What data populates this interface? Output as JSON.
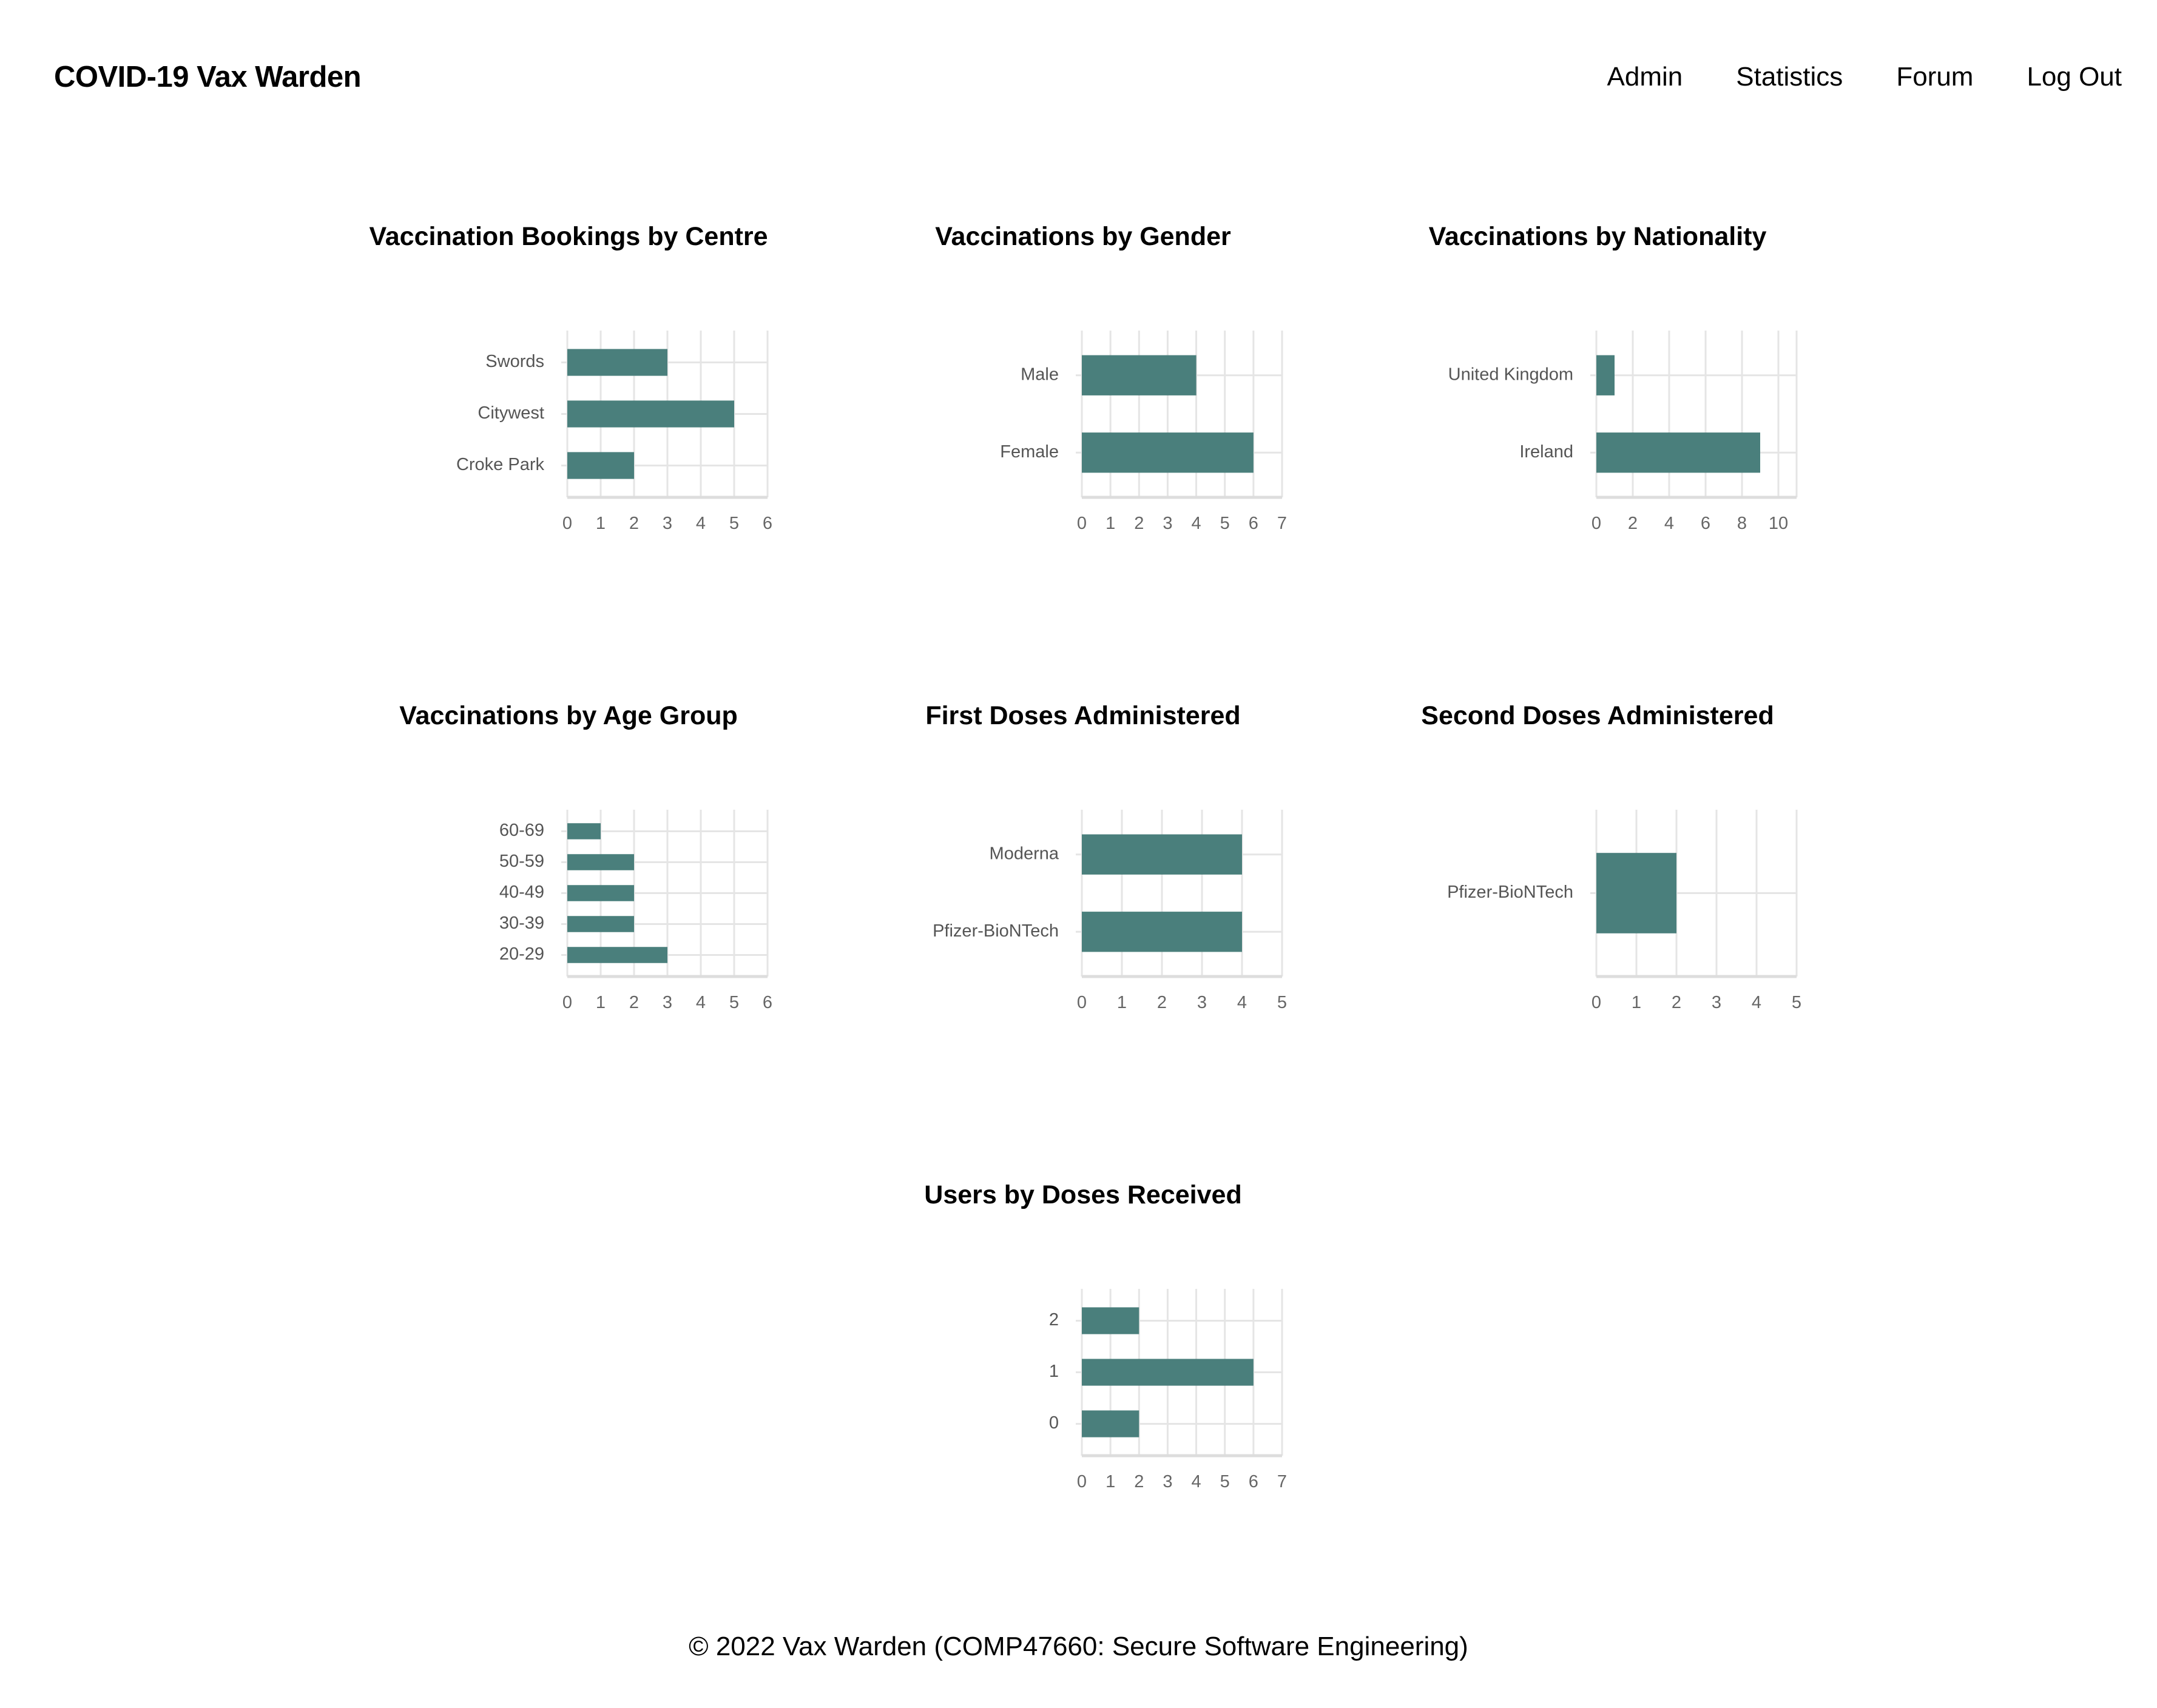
{
  "app": {
    "brand": "COVID-19 Vax Warden"
  },
  "nav": {
    "items": [
      {
        "label": "Admin"
      },
      {
        "label": "Statistics"
      },
      {
        "label": "Forum"
      },
      {
        "label": "Log Out"
      }
    ]
  },
  "footer": {
    "text": "© 2022 Vax Warden (COMP47660: Secure Software Engineering)"
  },
  "colors": {
    "bar": "#4a7f7c",
    "grid": "#e5e5e5",
    "tick_text": "#666666",
    "category_text": "#555555"
  },
  "chart_data": [
    {
      "type": "bar",
      "orientation": "horizontal",
      "title": "Vaccination Bookings by Centre",
      "categories": [
        "Swords",
        "Citywest",
        "Croke Park"
      ],
      "values": [
        3,
        5,
        2
      ],
      "xlim": [
        0,
        6
      ],
      "xticks": [
        0,
        1,
        2,
        3,
        4,
        5,
        6
      ],
      "grid": true,
      "legend": "none"
    },
    {
      "type": "bar",
      "orientation": "horizontal",
      "title": "Vaccinations by Gender",
      "categories": [
        "Male",
        "Female"
      ],
      "values": [
        4,
        6
      ],
      "xlim": [
        0,
        7
      ],
      "xticks": [
        0,
        1,
        2,
        3,
        4,
        5,
        6,
        7
      ],
      "grid": true,
      "legend": "none"
    },
    {
      "type": "bar",
      "orientation": "horizontal",
      "title": "Vaccinations by Nationality",
      "categories": [
        "United Kingdom",
        "Ireland"
      ],
      "values": [
        1,
        9
      ],
      "xlim": [
        0,
        11
      ],
      "xticks": [
        0,
        2,
        4,
        6,
        8,
        10
      ],
      "grid": true,
      "legend": "none"
    },
    {
      "type": "bar",
      "orientation": "horizontal",
      "title": "Vaccinations by Age Group",
      "categories": [
        "60-69",
        "50-59",
        "40-49",
        "30-39",
        "20-29"
      ],
      "values": [
        1,
        2,
        2,
        2,
        3
      ],
      "xlim": [
        0,
        6
      ],
      "xticks": [
        0,
        1,
        2,
        3,
        4,
        5,
        6
      ],
      "grid": true,
      "legend": "none"
    },
    {
      "type": "bar",
      "orientation": "horizontal",
      "title": "First Doses Administered",
      "categories": [
        "Moderna",
        "Pfizer-BioNTech"
      ],
      "values": [
        4,
        4
      ],
      "xlim": [
        0,
        5
      ],
      "xticks": [
        0,
        1,
        2,
        3,
        4,
        5
      ],
      "grid": true,
      "legend": "none"
    },
    {
      "type": "bar",
      "orientation": "horizontal",
      "title": "Second Doses Administered",
      "categories": [
        "Pfizer-BioNTech"
      ],
      "values": [
        2
      ],
      "xlim": [
        0,
        5
      ],
      "xticks": [
        0,
        1,
        2,
        3,
        4,
        5
      ],
      "grid": true,
      "legend": "none"
    },
    {
      "type": "bar",
      "orientation": "horizontal",
      "title": "Users by Doses Received",
      "categories": [
        "2",
        "1",
        "0"
      ],
      "values": [
        2,
        6,
        2
      ],
      "xlim": [
        0,
        7
      ],
      "xticks": [
        0,
        1,
        2,
        3,
        4,
        5,
        6,
        7
      ],
      "grid": true,
      "legend": "none"
    }
  ]
}
